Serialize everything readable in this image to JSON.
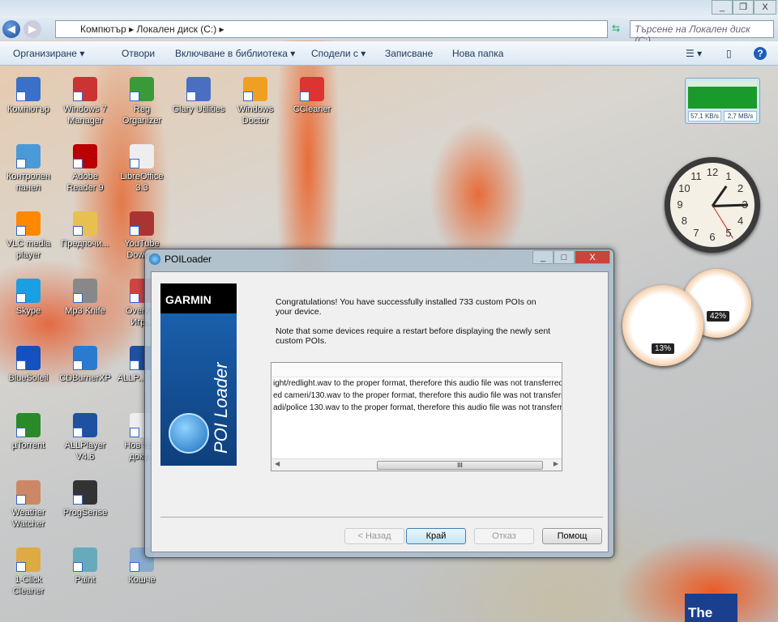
{
  "explorer": {
    "window_controls": [
      "_",
      "❐",
      "X"
    ],
    "breadcrumb": [
      "Компютър",
      "Локален диск (C:)"
    ],
    "search_placeholder": "Търсене на Локален диск (C:)",
    "toolbar": [
      "Организиране ▾",
      "Отвори",
      "Включване в библиотека ▾",
      "Сподели с ▾",
      "Записване",
      "Нова папка"
    ]
  },
  "desktop_icons": [
    {
      "label": "Компютър",
      "color": "#3a70c8"
    },
    {
      "label": "Windows 7 Manager",
      "color": "#c33"
    },
    {
      "label": "Reg Organizer",
      "color": "#3a9a3a"
    },
    {
      "label": "Glary Utilities",
      "color": "#4a6fc0"
    },
    {
      "label": "Windows Doctor",
      "color": "#f0a020"
    },
    {
      "label": "CCleaner",
      "color": "#d33"
    },
    {
      "label": "Контролен панел",
      "color": "#4a9ad8"
    },
    {
      "label": "Adobe Reader 9",
      "color": "#b00"
    },
    {
      "label": "LibreOffice 3.3",
      "color": "#eee"
    },
    {
      "label": "VLC media player",
      "color": "#f80"
    },
    {
      "label": "Предпочи...",
      "color": "#e8c050"
    },
    {
      "label": "YouTube Down...",
      "color": "#a33"
    },
    {
      "label": "Skype",
      "color": "#1aa0e0"
    },
    {
      "label": "Mp3 Knife",
      "color": "#888"
    },
    {
      "label": "OverK... Игр...",
      "color": "#c44"
    },
    {
      "label": "BlueSoleil",
      "color": "#1450c0"
    },
    {
      "label": "CDBurnerXP",
      "color": "#2a7ad0"
    },
    {
      "label": "ALLP... V4...",
      "color": "#2050a0"
    },
    {
      "label": "µTorrent",
      "color": "#2a8a2a"
    },
    {
      "label": "ALLPlayer V4.6",
      "color": "#2050a0"
    },
    {
      "label": "Нов те... доку...",
      "color": "#eee"
    },
    {
      "label": "Weather Watcher",
      "color": "#c86"
    },
    {
      "label": "ProgSense",
      "color": "#333"
    },
    {
      "label": "1-Click Cleaner",
      "color": "#da4"
    },
    {
      "label": "Paint",
      "color": "#6ab"
    },
    {
      "label": "Кошче",
      "color": "#8ac"
    }
  ],
  "gadgets": {
    "net_upload": "57,1 KB/s",
    "net_download": "2,7 MB/s",
    "clock_numbers": [
      "12",
      "1",
      "2",
      "3",
      "4",
      "5",
      "6",
      "7",
      "8",
      "9",
      "10",
      "11"
    ],
    "cpu_percent": "13%",
    "ram_percent": "42%",
    "cpu_value": 13,
    "ram_value": 42
  },
  "dialog": {
    "title": "POILoader",
    "brand": "GARMIN",
    "product": "POI Loader",
    "message1": "Congratulations! You have successfully installed 733 custom POIs on your device.",
    "message2": "Note that some devices require a restart before displaying the newly sent custom POIs.",
    "log_lines": [
      "ight/redlight.wav to the proper format, therefore this audio file was not transferred.",
      "ed cameri/130.wav to the proper format, therefore this audio file was not transferre",
      "adi/police 130.wav to the proper format, therefore this audio file was not transferre"
    ],
    "scroll_grip": "III",
    "buttons": {
      "back": "< Назад",
      "finish": "Край",
      "cancel": "Отказ",
      "help": "Помощ"
    }
  },
  "corner_logo": "The"
}
